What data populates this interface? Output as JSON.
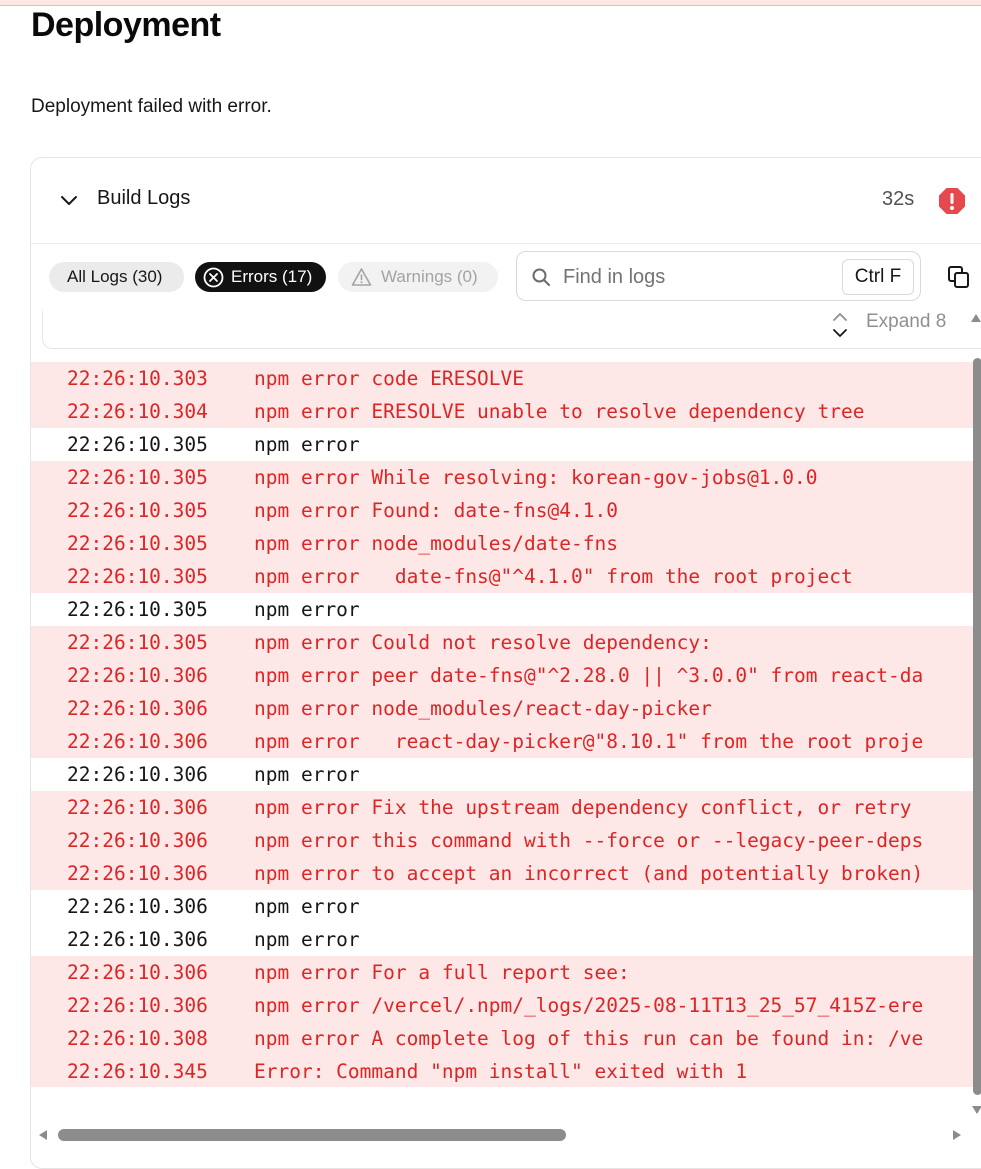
{
  "page": {
    "title": "Deployment",
    "status_text": "Deployment failed with error."
  },
  "build_logs": {
    "title": "Build Logs",
    "duration": "32s",
    "status": "error",
    "status_icon": "exclamation-circle-icon",
    "error_color": "#e5484d"
  },
  "filters": {
    "all": "All Logs (30)",
    "errors": "Errors (17)",
    "warnings": "Warnings (0)",
    "active": "errors"
  },
  "search": {
    "placeholder": "Find in logs",
    "value": "",
    "shortcut": "Ctrl F"
  },
  "expand": {
    "label": "Expand 8"
  },
  "colors": {
    "error_text": "#dc2626",
    "error_row_bg": "#fde7e7",
    "active_filter_bg": "#111111"
  },
  "logs": [
    {
      "time": "22:26:10.303",
      "message": "npm error code ERESOLVE",
      "level": "error"
    },
    {
      "time": "22:26:10.304",
      "message": "npm error ERESOLVE unable to resolve dependency tree",
      "level": "error"
    },
    {
      "time": "22:26:10.305",
      "message": "npm error",
      "level": "plain"
    },
    {
      "time": "22:26:10.305",
      "message": "npm error While resolving: korean-gov-jobs@1.0.0",
      "level": "error"
    },
    {
      "time": "22:26:10.305",
      "message": "npm error Found: date-fns@4.1.0",
      "level": "error"
    },
    {
      "time": "22:26:10.305",
      "message": "npm error node_modules/date-fns",
      "level": "error"
    },
    {
      "time": "22:26:10.305",
      "message": "npm error   date-fns@\"^4.1.0\" from the root project",
      "level": "error"
    },
    {
      "time": "22:26:10.305",
      "message": "npm error",
      "level": "plain"
    },
    {
      "time": "22:26:10.305",
      "message": "npm error Could not resolve dependency:",
      "level": "error"
    },
    {
      "time": "22:26:10.306",
      "message": "npm error peer date-fns@\"^2.28.0 || ^3.0.0\" from react-da",
      "level": "error"
    },
    {
      "time": "22:26:10.306",
      "message": "npm error node_modules/react-day-picker",
      "level": "error"
    },
    {
      "time": "22:26:10.306",
      "message": "npm error   react-day-picker@\"8.10.1\" from the root proje",
      "level": "error"
    },
    {
      "time": "22:26:10.306",
      "message": "npm error",
      "level": "plain"
    },
    {
      "time": "22:26:10.306",
      "message": "npm error Fix the upstream dependency conflict, or retry",
      "level": "error"
    },
    {
      "time": "22:26:10.306",
      "message": "npm error this command with --force or --legacy-peer-deps",
      "level": "error"
    },
    {
      "time": "22:26:10.306",
      "message": "npm error to accept an incorrect (and potentially broken)",
      "level": "error"
    },
    {
      "time": "22:26:10.306",
      "message": "npm error",
      "level": "plain"
    },
    {
      "time": "22:26:10.306",
      "message": "npm error",
      "level": "plain"
    },
    {
      "time": "22:26:10.306",
      "message": "npm error For a full report see:",
      "level": "error"
    },
    {
      "time": "22:26:10.306",
      "message": "npm error /vercel/.npm/_logs/2025-08-11T13_25_57_415Z-ere",
      "level": "error"
    },
    {
      "time": "22:26:10.308",
      "message": "npm error A complete log of this run can be found in: /ve",
      "level": "error"
    },
    {
      "time": "22:26:10.345",
      "message": "Error: Command \"npm install\" exited with 1",
      "level": "error"
    }
  ]
}
